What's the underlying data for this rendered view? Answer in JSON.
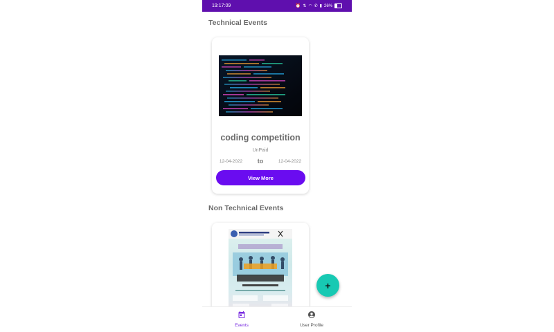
{
  "status_bar": {
    "time": "19:17:09",
    "battery_percent": "26%",
    "indicators": [
      "alarm-icon",
      "data-speed-icon",
      "wifi-icon",
      "volte-icon",
      "signal-icon",
      "battery-icon"
    ]
  },
  "sections": {
    "technical": {
      "title": "Technical Events",
      "card": {
        "title": "coding competition",
        "payment": "UnPaid",
        "start_date": "12-04-2022",
        "separator": "to",
        "end_date": "12-04-2022",
        "button_label": "View More"
      }
    },
    "non_technical": {
      "title": "Non Technical Events"
    }
  },
  "fab": {
    "icon": "plus-icon"
  },
  "bottom_nav": {
    "items": [
      {
        "label": "Events",
        "icon": "calendar-icon",
        "active": true
      },
      {
        "label": "User Profile",
        "icon": "account-circle-icon",
        "active": false
      }
    ]
  },
  "colors": {
    "status_bar": "#5f0fae",
    "accent": "#6a0cf0",
    "fab": "#17c9b3",
    "active_nav": "#7a2ce0",
    "inactive_nav": "#555555"
  }
}
